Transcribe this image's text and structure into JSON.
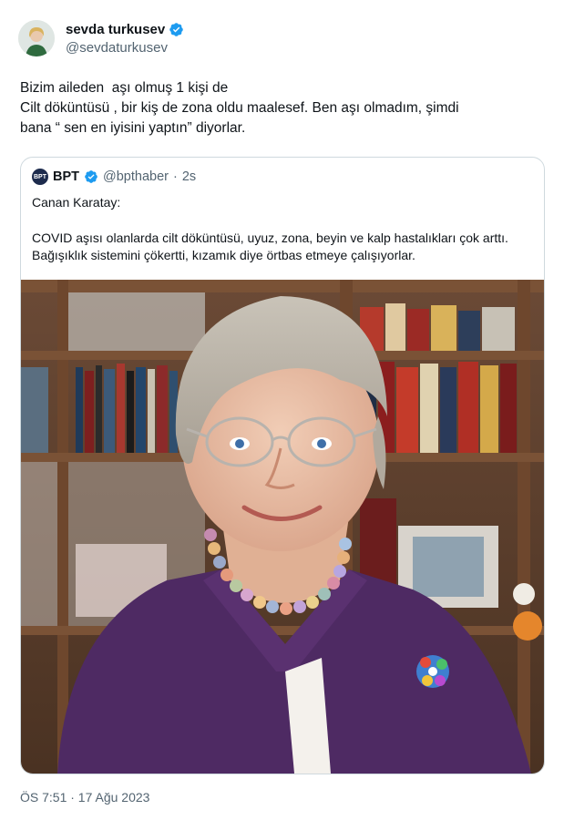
{
  "author": {
    "display_name": "sevda turkusev",
    "handle": "@sevdaturkusev",
    "verified_icon": "verified-badge-icon",
    "avatar_icon": "avatar-photo-icon"
  },
  "tweet": {
    "text": "Bizim aileden  aşı olmuş 1 kişi de\nCilt döküntüsü , bir kiş de zona oldu maalesef. Ben aşı olmadım, şimdi\nbana “ sen en iyisini yaptın” diyorlar.",
    "timestamp": "ÖS 7:51 · 17 Ağu 2023"
  },
  "quoted": {
    "logo_text": "BPT",
    "name": "BPT",
    "handle": "@bpthaber",
    "separator": "·",
    "time": "2s",
    "line1": "Canan Karatay:",
    "line2": "COVID aşısı olanlarda cilt döküntüsü, uyuz, zona, beyin ve kalp hastalıkları çok arttı. Bağışıklık sistemini çökertti, kızamık diye örtbas etmeye çalışıyorlar.",
    "image_icon": "portrait-photo-icon"
  },
  "colors": {
    "verified": "#1d9bf0",
    "secondary_text": "#536471",
    "border": "#cfd9de"
  }
}
